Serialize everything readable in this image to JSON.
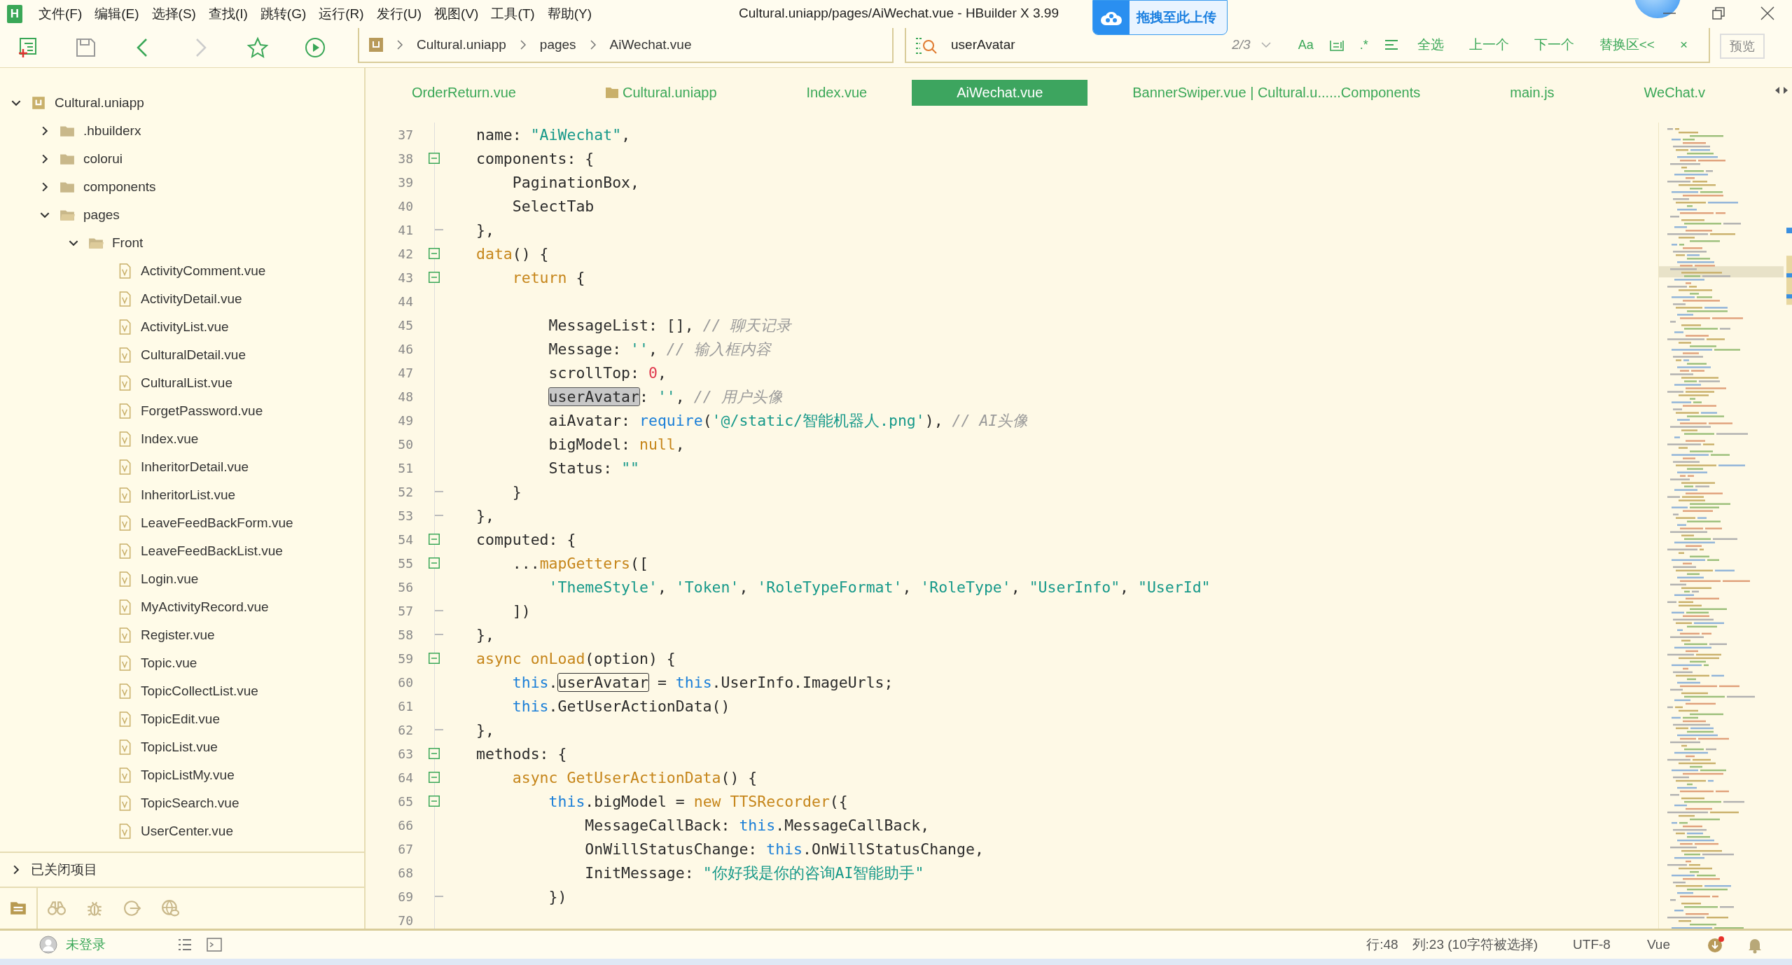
{
  "title_bar": {
    "logo": "H",
    "menu": [
      "文件(F)",
      "编辑(E)",
      "选择(S)",
      "查找(I)",
      "跳转(G)",
      "运行(R)",
      "发行(U)",
      "视图(V)",
      "工具(T)",
      "帮助(Y)"
    ],
    "title": "Cultural.uniapp/pages/AiWechat.vue - HBuilder X 3.99",
    "upload_button": "拖拽至此上传"
  },
  "toolbar": {
    "breadcrumb": [
      "Cultural.uniapp",
      "pages",
      "AiWechat.vue"
    ],
    "search": {
      "value": "userAvatar",
      "count": "2/3",
      "case_label": "Aa",
      "regex_label": ".*",
      "actions": [
        "全选",
        "上一个",
        "下一个",
        "替换区<<"
      ],
      "close_label": "×"
    },
    "preview_button": "预览"
  },
  "tabs": [
    {
      "label": "OrderReturn.vue",
      "kind": "file",
      "selected": false
    },
    {
      "label": "Cultural.uniapp",
      "kind": "folder",
      "selected": false
    },
    {
      "label": "Index.vue",
      "kind": "file",
      "selected": false
    },
    {
      "label": "AiWechat.vue",
      "kind": "file",
      "selected": true
    },
    {
      "label": "BannerSwiper.vue | Cultural.u......Components",
      "kind": "file",
      "selected": false
    },
    {
      "label": "main.js",
      "kind": "file",
      "selected": false
    },
    {
      "label": "WeChat.v",
      "kind": "file",
      "selected": false
    }
  ],
  "sidebar": {
    "tree": [
      {
        "label": "Cultural.uniapp",
        "kind": "project",
        "expanded": true,
        "children": [
          {
            "label": ".hbuilderx",
            "kind": "folder",
            "expanded": false
          },
          {
            "label": "colorui",
            "kind": "folder",
            "expanded": false
          },
          {
            "label": "components",
            "kind": "folder",
            "expanded": false
          },
          {
            "label": "pages",
            "kind": "folder",
            "expanded": true,
            "children": [
              {
                "label": "Front",
                "kind": "folder",
                "expanded": true,
                "children": [
                  {
                    "label": "ActivityComment.vue",
                    "kind": "file"
                  },
                  {
                    "label": "ActivityDetail.vue",
                    "kind": "file"
                  },
                  {
                    "label": "ActivityList.vue",
                    "kind": "file"
                  },
                  {
                    "label": "CulturalDetail.vue",
                    "kind": "file"
                  },
                  {
                    "label": "CulturalList.vue",
                    "kind": "file"
                  },
                  {
                    "label": "ForgetPassword.vue",
                    "kind": "file"
                  },
                  {
                    "label": "Index.vue",
                    "kind": "file"
                  },
                  {
                    "label": "InheritorDetail.vue",
                    "kind": "file"
                  },
                  {
                    "label": "InheritorList.vue",
                    "kind": "file"
                  },
                  {
                    "label": "LeaveFeedBackForm.vue",
                    "kind": "file"
                  },
                  {
                    "label": "LeaveFeedBackList.vue",
                    "kind": "file"
                  },
                  {
                    "label": "Login.vue",
                    "kind": "file"
                  },
                  {
                    "label": "MyActivityRecord.vue",
                    "kind": "file"
                  },
                  {
                    "label": "Register.vue",
                    "kind": "file"
                  },
                  {
                    "label": "Topic.vue",
                    "kind": "file"
                  },
                  {
                    "label": "TopicCollectList.vue",
                    "kind": "file"
                  },
                  {
                    "label": "TopicEdit.vue",
                    "kind": "file"
                  },
                  {
                    "label": "TopicList.vue",
                    "kind": "file"
                  },
                  {
                    "label": "TopicListMy.vue",
                    "kind": "file"
                  },
                  {
                    "label": "TopicSearch.vue",
                    "kind": "file"
                  },
                  {
                    "label": "UserCenter.vue",
                    "kind": "file"
                  }
                ]
              }
            ]
          }
        ]
      }
    ],
    "closed_projects": "已关闭项目",
    "panel_tabs": [
      {
        "kind": "explorer",
        "selected": true
      },
      {
        "kind": "binoculars",
        "selected": false
      },
      {
        "kind": "bug",
        "selected": false
      },
      {
        "kind": "export",
        "selected": false
      },
      {
        "kind": "globe",
        "selected": false
      }
    ]
  },
  "editor": {
    "lines": [
      {
        "number": "37",
        "kind": "plain",
        "segments": [
          {
            "kind": "plain",
            "text": "name: "
          },
          {
            "kind": "string",
            "text": "\"AiWechat\""
          },
          {
            "kind": "plain",
            "text": ","
          }
        ]
      },
      {
        "number": "38",
        "kind": "foldstart",
        "segments": [
          {
            "kind": "plain",
            "text": "components: {"
          }
        ]
      },
      {
        "number": "39",
        "kind": "plain",
        "segments": [
          {
            "kind": "plain",
            "text": "    PaginationBox,"
          }
        ]
      },
      {
        "number": "40",
        "kind": "plain",
        "segments": [
          {
            "kind": "plain",
            "text": "    SelectTab"
          }
        ]
      },
      {
        "number": "41",
        "kind": "foldend",
        "segments": [
          {
            "kind": "plain",
            "text": "},"
          }
        ]
      },
      {
        "number": "42",
        "kind": "foldstart",
        "segments": [
          {
            "kind": "function",
            "text": "data"
          },
          {
            "kind": "plain",
            "text": "() {"
          }
        ]
      },
      {
        "number": "43",
        "kind": "foldstart",
        "segments": [
          {
            "kind": "function",
            "text": "    return"
          },
          {
            "kind": "plain",
            "text": " {"
          }
        ]
      },
      {
        "number": "44",
        "kind": "plain"
      },
      {
        "number": "45",
        "kind": "plain",
        "segments": [
          {
            "kind": "plain",
            "text": "        MessageList: [], "
          },
          {
            "kind": "comment",
            "text": "// 聊天记录"
          }
        ]
      },
      {
        "number": "46",
        "kind": "plain",
        "segments": [
          {
            "kind": "plain",
            "text": "        Message: "
          },
          {
            "kind": "string",
            "text": "''"
          },
          {
            "kind": "plain",
            "text": ", "
          },
          {
            "kind": "comment",
            "text": "// 输入框内容"
          }
        ]
      },
      {
        "number": "47",
        "kind": "plain",
        "segments": [
          {
            "kind": "plain",
            "text": "        scrollTop: "
          },
          {
            "kind": "number",
            "text": "0"
          },
          {
            "kind": "plain",
            "text": ","
          }
        ]
      },
      {
        "number": "48",
        "kind": "plain",
        "segments": [
          {
            "kind": "selection",
            "text": "        userAvatar"
          },
          {
            "kind": "plain",
            "text": ": "
          },
          {
            "kind": "string",
            "text": "''"
          },
          {
            "kind": "plain",
            "text": ", "
          },
          {
            "kind": "comment",
            "text": "// 用户头像"
          }
        ]
      },
      {
        "number": "49",
        "kind": "plain",
        "segments": [
          {
            "kind": "plain",
            "text": "        aiAvatar: "
          },
          {
            "kind": "keyword",
            "text": "require"
          },
          {
            "kind": "plain",
            "text": "("
          },
          {
            "kind": "string",
            "text": "'@/static/智能机器人.png'"
          },
          {
            "kind": "plain",
            "text": "), "
          },
          {
            "kind": "comment",
            "text": "// AI头像"
          }
        ]
      },
      {
        "number": "50",
        "kind": "plain",
        "segments": [
          {
            "kind": "plain",
            "text": "        bigModel: "
          },
          {
            "kind": "function",
            "text": "null"
          },
          {
            "kind": "plain",
            "text": ","
          }
        ]
      },
      {
        "number": "51",
        "kind": "plain",
        "segments": [
          {
            "kind": "plain",
            "text": "        Status: "
          },
          {
            "kind": "string",
            "text": "\"\""
          }
        ]
      },
      {
        "number": "52",
        "kind": "foldend",
        "segments": [
          {
            "kind": "plain",
            "text": "    }"
          }
        ]
      },
      {
        "number": "53",
        "kind": "foldend",
        "segments": [
          {
            "kind": "plain",
            "text": "},"
          }
        ]
      },
      {
        "number": "54",
        "kind": "foldstart",
        "segments": [
          {
            "kind": "plain",
            "text": "computed: {"
          }
        ]
      },
      {
        "number": "55",
        "kind": "foldstart",
        "segments": [
          {
            "kind": "plain",
            "text": "    ..."
          },
          {
            "kind": "function",
            "text": "mapGetters"
          },
          {
            "kind": "plain",
            "text": "(["
          }
        ]
      },
      {
        "number": "56",
        "kind": "plain",
        "segments": [
          {
            "kind": "string",
            "text": "        'ThemeStyle'"
          },
          {
            "kind": "plain",
            "text": ", "
          },
          {
            "kind": "string",
            "text": "'Token'"
          },
          {
            "kind": "plain",
            "text": ", "
          },
          {
            "kind": "string",
            "text": "'RoleTypeFormat'"
          },
          {
            "kind": "plain",
            "text": ", "
          },
          {
            "kind": "string",
            "text": "'RoleType'"
          },
          {
            "kind": "plain",
            "text": ", "
          },
          {
            "kind": "string",
            "text": "\"UserInfo\""
          },
          {
            "kind": "plain",
            "text": ", "
          },
          {
            "kind": "string",
            "text": "\"UserId\""
          }
        ]
      },
      {
        "number": "57",
        "kind": "foldend",
        "segments": [
          {
            "kind": "plain",
            "text": "    ])"
          }
        ]
      },
      {
        "number": "58",
        "kind": "foldend",
        "segments": [
          {
            "kind": "plain",
            "text": "},"
          }
        ]
      },
      {
        "number": "59",
        "kind": "foldstart",
        "segments": [
          {
            "kind": "function",
            "text": "async onLoad"
          },
          {
            "kind": "plain",
            "text": "(option) {"
          }
        ]
      },
      {
        "number": "60",
        "kind": "plain",
        "segments": [
          {
            "kind": "keyword",
            "text": "    this"
          },
          {
            "kind": "plain",
            "text": "."
          },
          {
            "kind": "match",
            "text": "userAvatar"
          },
          {
            "kind": "plain",
            "text": " = "
          },
          {
            "kind": "keyword",
            "text": "this"
          },
          {
            "kind": "plain",
            "text": ".UserInfo.ImageUrls;"
          }
        ]
      },
      {
        "number": "61",
        "kind": "plain",
        "segments": [
          {
            "kind": "keyword",
            "text": "    this"
          },
          {
            "kind": "plain",
            "text": ".GetUserActionData()"
          }
        ]
      },
      {
        "number": "62",
        "kind": "foldend",
        "segments": [
          {
            "kind": "plain",
            "text": "},"
          }
        ]
      },
      {
        "number": "63",
        "kind": "foldstart",
        "segments": [
          {
            "kind": "plain",
            "text": "methods: {"
          }
        ]
      },
      {
        "number": "64",
        "kind": "foldstart",
        "segments": [
          {
            "kind": "function",
            "text": "    async GetUserActionData"
          },
          {
            "kind": "plain",
            "text": "() {"
          }
        ]
      },
      {
        "number": "65",
        "kind": "foldstart",
        "segments": [
          {
            "kind": "keyword",
            "text": "        this"
          },
          {
            "kind": "plain",
            "text": ".bigModel = "
          },
          {
            "kind": "function",
            "text": "new TTSRecorder"
          },
          {
            "kind": "plain",
            "text": "({"
          }
        ]
      },
      {
        "number": "66",
        "kind": "plain",
        "segments": [
          {
            "kind": "plain",
            "text": "            MessageCallBack: "
          },
          {
            "kind": "keyword",
            "text": "this"
          },
          {
            "kind": "plain",
            "text": ".MessageCallBack,"
          }
        ]
      },
      {
        "number": "67",
        "kind": "plain",
        "segments": [
          {
            "kind": "plain",
            "text": "            OnWillStatusChange: "
          },
          {
            "kind": "keyword",
            "text": "this"
          },
          {
            "kind": "plain",
            "text": ".OnWillStatusChange,"
          }
        ]
      },
      {
        "number": "68",
        "kind": "plain",
        "segments": [
          {
            "kind": "plain",
            "text": "            InitMessage: "
          },
          {
            "kind": "string",
            "text": "\"你好我是你的咨询AI智能助手\""
          }
        ]
      },
      {
        "number": "69",
        "kind": "foldend",
        "segments": [
          {
            "kind": "plain",
            "text": "        })"
          }
        ]
      },
      {
        "number": "70",
        "kind": "plain"
      }
    ]
  },
  "status_bar": {
    "user": "未登录",
    "line": "行:48",
    "column": "列:23 (10字符被选择)",
    "encoding": "UTF-8",
    "language": "Vue"
  }
}
